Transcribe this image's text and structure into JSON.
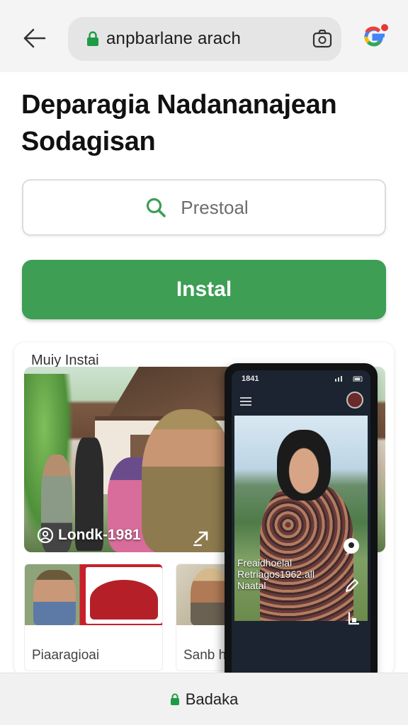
{
  "browser": {
    "url": "anpbarlane arach",
    "back_icon": "arrow-left-icon",
    "lock_icon": "lock-icon",
    "camera_icon": "camera-icon",
    "profile_icon": "google-g-icon"
  },
  "page": {
    "title": "Deparagia Nadananajean Sodagisan"
  },
  "search": {
    "placeholder": "Prestoal"
  },
  "install_button": {
    "label": "Instal"
  },
  "card": {
    "label": "Muiy Instai",
    "hero_caption": "Londk-1981",
    "thumbnails": [
      {
        "label": "Piaaragioai"
      },
      {
        "label": "Sanb hestaers"
      }
    ]
  },
  "phone": {
    "time": "1841",
    "caption_line1": "Freaidhoelal",
    "caption_line2": "Retriagos1962.all",
    "caption_line3": "Naatal"
  },
  "bottom_bar": {
    "label": "Badaka"
  },
  "colors": {
    "accent_green": "#3d9e54",
    "lock_green": "#1e9b45"
  }
}
